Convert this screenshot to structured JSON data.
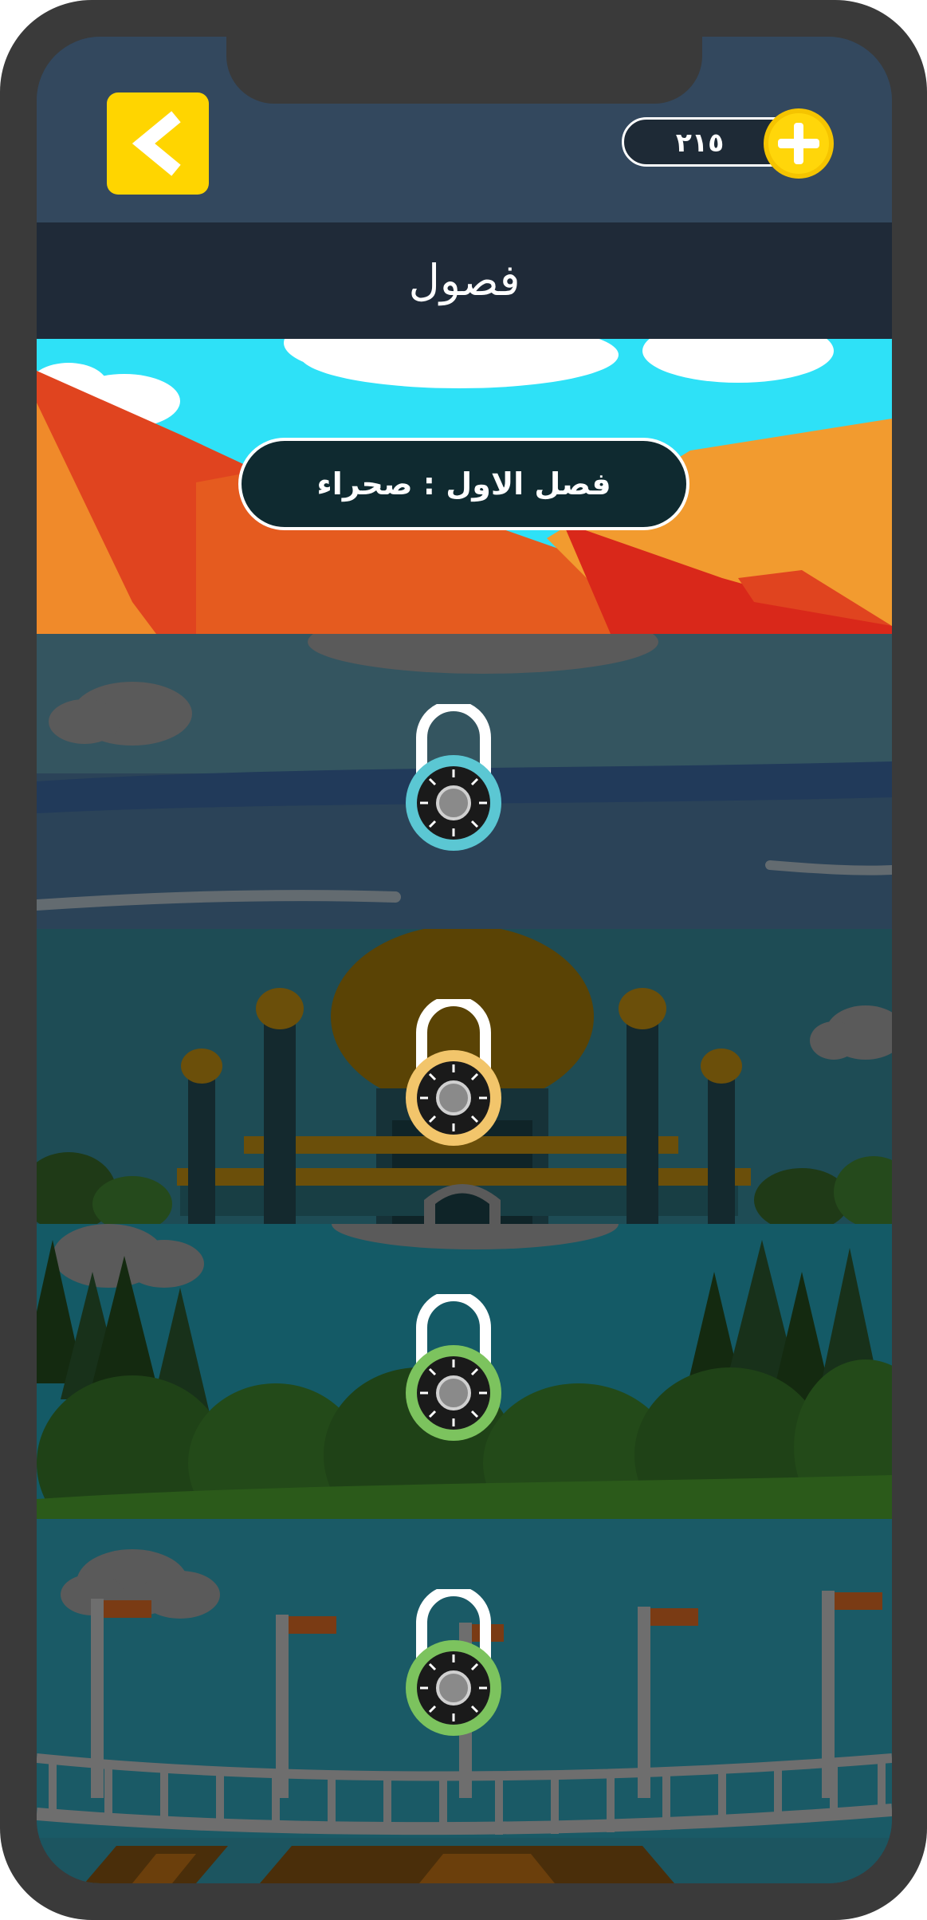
{
  "header": {
    "coins": "٢١٥"
  },
  "page": {
    "title": "فصول"
  },
  "chapters": [
    {
      "label": "فصل الاول : صحراء",
      "locked": false,
      "theme": "desert"
    },
    {
      "locked": true,
      "theme": "sea",
      "lock_color": "#5bc7d3"
    },
    {
      "locked": true,
      "theme": "mosque",
      "lock_color": "#f2c56b"
    },
    {
      "locked": true,
      "theme": "forest",
      "lock_color": "#7cc35e"
    },
    {
      "locked": true,
      "theme": "bridge",
      "lock_color": "#7cc35e"
    }
  ],
  "icons": {
    "back": "chevron-left-icon",
    "add": "plus-icon",
    "lock": "lock-icon"
  },
  "colors": {
    "accent": "#ffd500",
    "header_bg": "#33485e",
    "title_bar_bg": "#1f2a38"
  }
}
